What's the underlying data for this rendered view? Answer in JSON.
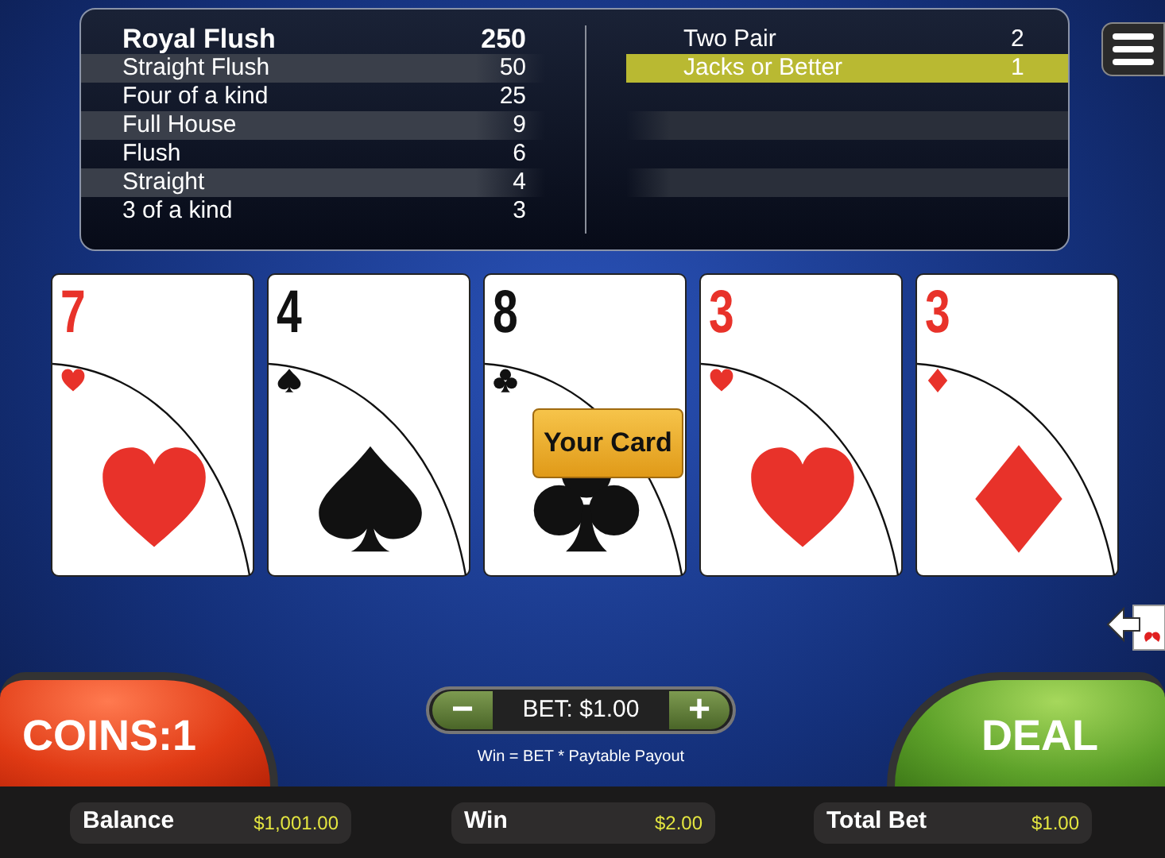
{
  "paytable": {
    "left": [
      {
        "hand": "Royal Flush",
        "payout": "250",
        "top": true,
        "selected": false
      },
      {
        "hand": "Straight Flush",
        "payout": "50",
        "top": false,
        "selected": false
      },
      {
        "hand": "Four of a kind",
        "payout": "25",
        "top": false,
        "selected": false
      },
      {
        "hand": "Full House",
        "payout": "9",
        "top": false,
        "selected": false
      },
      {
        "hand": "Flush",
        "payout": "6",
        "top": false,
        "selected": false
      },
      {
        "hand": "Straight",
        "payout": "4",
        "top": false,
        "selected": false
      },
      {
        "hand": "3 of a kind",
        "payout": "3",
        "top": false,
        "selected": false
      }
    ],
    "right": [
      {
        "hand": "Two Pair",
        "payout": "2",
        "selected": false
      },
      {
        "hand": "Jacks or Better",
        "payout": "1",
        "selected": true
      }
    ]
  },
  "cards": [
    {
      "rank": "7",
      "kind": "hearts"
    },
    {
      "rank": "4",
      "kind": "spades"
    },
    {
      "rank": "8",
      "kind": "clubs",
      "badge": "Your Card"
    },
    {
      "rank": "3",
      "kind": "hearts"
    },
    {
      "rank": "3",
      "kind": "diamonds"
    }
  ],
  "coins_button": "COINS:1",
  "bet": {
    "minus": "−",
    "label": "BET: $1.00",
    "plus": "+",
    "note": "Win = BET * Paytable Payout"
  },
  "deal_button": "DEAL",
  "stats": [
    {
      "label": "Balance",
      "value": "$1,001.00"
    },
    {
      "label": "Win",
      "value": "$2.00"
    },
    {
      "label": "Total Bet",
      "value": "$1.00"
    }
  ]
}
